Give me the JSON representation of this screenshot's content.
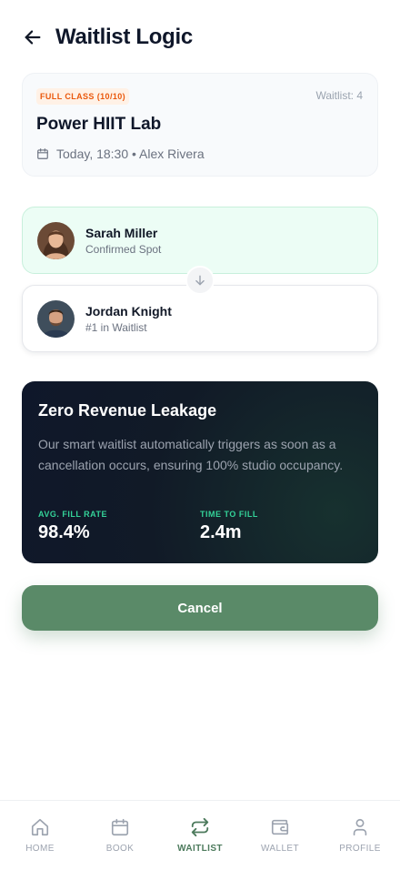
{
  "header": {
    "title": "Waitlist Logic"
  },
  "class_card": {
    "badge": "FULL CLASS (10/10)",
    "waitlist": "Waitlist: 4",
    "name": "Power HIIT Lab",
    "meta": "Today, 18:30 • Alex Rivera"
  },
  "people": [
    {
      "name": "Sarah Miller",
      "status": "Confirmed Spot"
    },
    {
      "name": "Jordan Knight",
      "status": "#1 in Waitlist"
    }
  ],
  "revenue": {
    "title": "Zero Revenue Leakage",
    "description": "Our smart waitlist automatically triggers as soon as a cancellation occurs, ensuring 100% studio occupancy.",
    "stats": [
      {
        "label": "AVG. FILL RATE",
        "value": "98.4%"
      },
      {
        "label": "TIME TO FILL",
        "value": "2.4m"
      }
    ]
  },
  "actions": {
    "cancel_label": "Cancel"
  },
  "nav": {
    "items": [
      {
        "label": "HOME",
        "icon": "home-icon"
      },
      {
        "label": "BOOK",
        "icon": "calendar-icon"
      },
      {
        "label": "WAITLIST",
        "icon": "swap-icon"
      },
      {
        "label": "WALLET",
        "icon": "wallet-icon"
      },
      {
        "label": "PROFILE",
        "icon": "user-icon"
      }
    ],
    "active": "WAITLIST"
  },
  "colors": {
    "accent": "#5a8a68",
    "active_nav": "#4c7a5c",
    "badge_text": "#ea580c",
    "stat_label": "#34d399",
    "dark_card": "#0f172a",
    "confirmed_bg": "#ecfdf5"
  }
}
